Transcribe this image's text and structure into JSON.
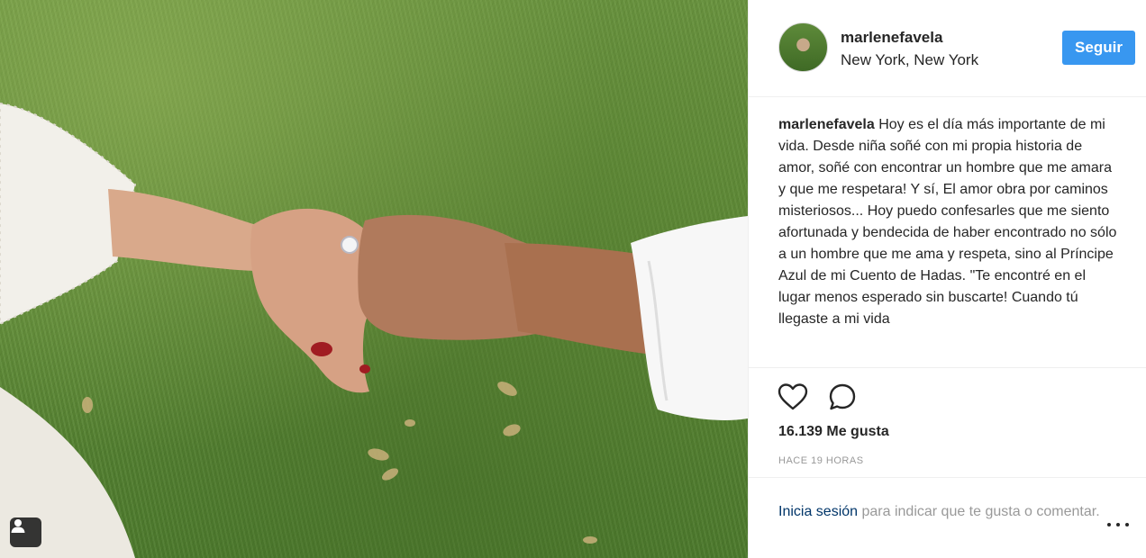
{
  "post": {
    "username": "marlenefavela",
    "location": "New York, New York",
    "follow_label": "Seguir",
    "caption_user": "marlenefavela",
    "caption_text": "Hoy es el día más importante de mi vida. Desde niña soñé con mi propia historia de amor, soñé con encontrar un hombre que me amara y que me respetara! Y sí, El amor obra por caminos misteriosos... Hoy puedo confesarles que me siento afortunada y bendecida de haber encontrado no sólo a un hombre que me ama y respeta, sino al Príncipe Azul de mi Cuento de Hadas. \"Te encontré en el lugar menos esperado sin buscarte! Cuando tú llegaste a mi vida",
    "likes": "16.139 Me gusta",
    "timestamp": "HACE 19 HORAS",
    "login_link": "Inicia sesión",
    "login_rest": " para indicar que te gusta o comentar."
  },
  "icons": {
    "tag": "user-tag-icon",
    "like": "heart-icon",
    "comment": "comment-bubble-icon",
    "more": "more-options-icon"
  },
  "colors": {
    "follow_button": "#3897f0",
    "grass": "#5f8c38",
    "muted_text": "#999999",
    "link": "#003569"
  }
}
